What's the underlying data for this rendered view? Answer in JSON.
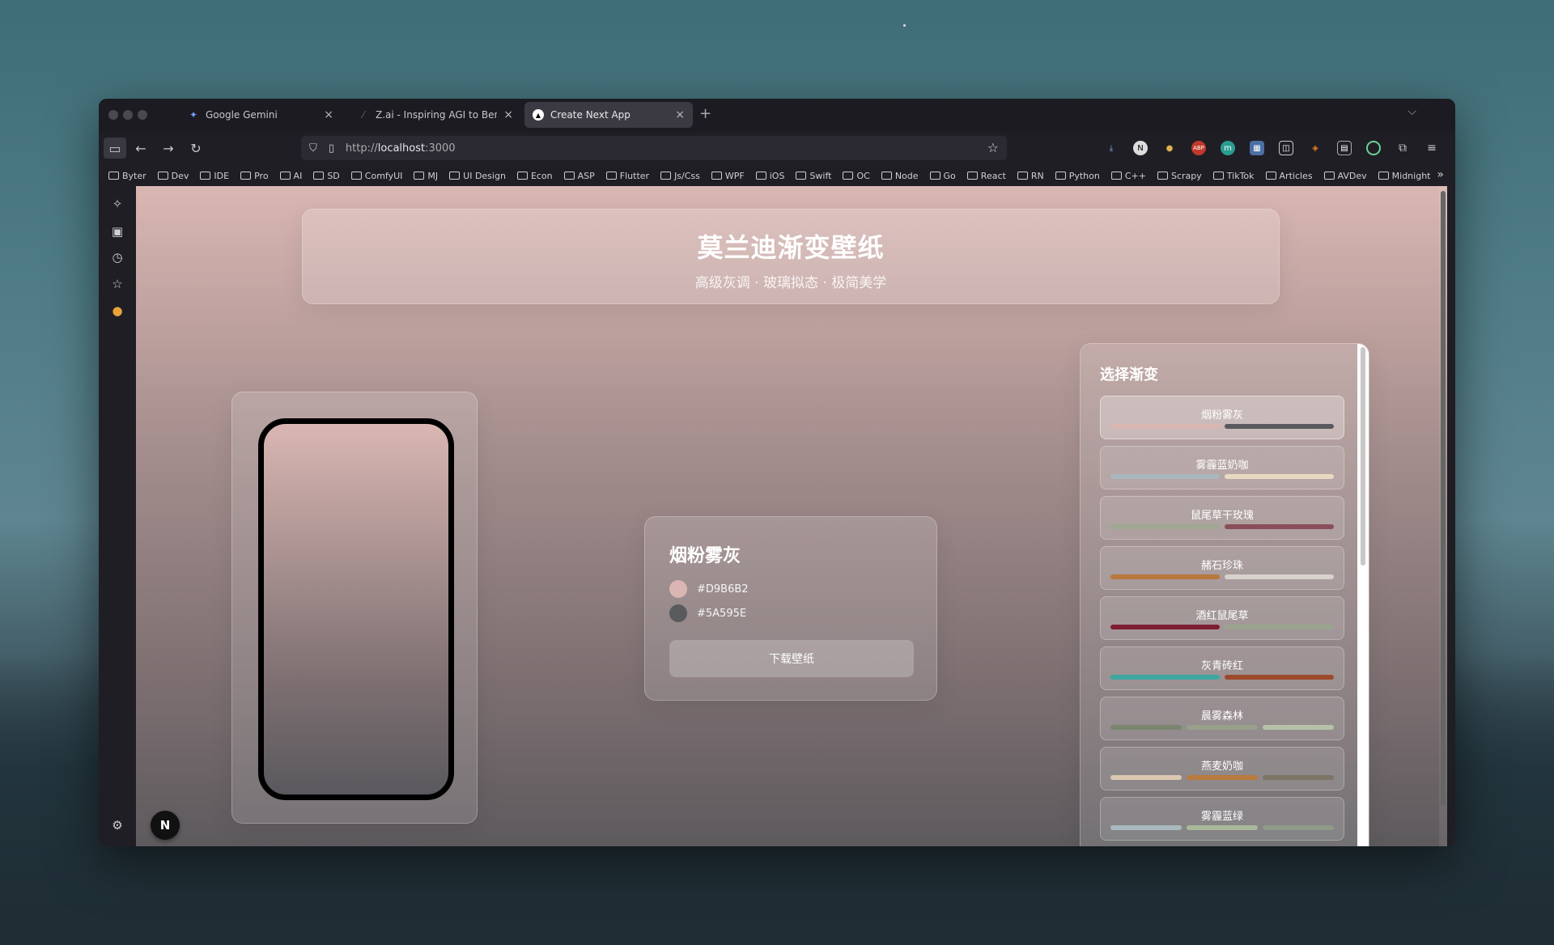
{
  "tabs": [
    {
      "title": "Google Gemini",
      "icon": "gemini-icon"
    },
    {
      "title": "Z.ai - Inspiring AGI to Benefit Humanity",
      "icon": "zai-icon"
    },
    {
      "title": "Create Next App",
      "icon": "nextjs-icon"
    }
  ],
  "url": {
    "scheme": "http://",
    "host": "localhost",
    "port": ":3000"
  },
  "bookmarks": [
    "Byter",
    "Dev",
    "IDE",
    "Pro",
    "AI",
    "SD",
    "ComfyUI",
    "MJ",
    "UI Design",
    "Econ",
    "ASP",
    "Flutter",
    "Js/Css",
    "WPF",
    "iOS",
    "Swift",
    "OC",
    "Node",
    "Go",
    "React",
    "RN",
    "Python",
    "C++",
    "Scrapy",
    "TikTok",
    "Articles",
    "AVDev",
    "Midnight"
  ],
  "header": {
    "title": "莫兰迪渐变壁纸",
    "subtitle": "高级灰调 · 玻璃拟态 · 极简美学"
  },
  "info": {
    "name": "烟粉雾灰",
    "colors": [
      {
        "hex": "#D9B6B2"
      },
      {
        "hex": "#5A595E"
      }
    ],
    "download_label": "下载壁纸"
  },
  "picker": {
    "title": "选择渐变",
    "options": [
      {
        "name": "烟粉雾灰",
        "colors": [
          "#D9B6B2",
          "#5A595E"
        ],
        "selected": true
      },
      {
        "name": "雾霾蓝奶咖",
        "colors": [
          "#A9B8BE",
          "#EAD9C2"
        ]
      },
      {
        "name": "鼠尾草干玫瑰",
        "colors": [
          "#9EA892",
          "#8A4E5A"
        ]
      },
      {
        "name": "赭石珍珠",
        "colors": [
          "#B8783E",
          "#D8D2CC"
        ]
      },
      {
        "name": "酒红鼠尾草",
        "colors": [
          "#7E1E32",
          "#9AA48E"
        ]
      },
      {
        "name": "灰青砖红",
        "colors": [
          "#3FA6A2",
          "#9C4A2C"
        ]
      },
      {
        "name": "晨雾森林",
        "colors": [
          "#7A8670",
          "#98A08C",
          "#B5C2A8"
        ]
      },
      {
        "name": "燕麦奶咖",
        "colors": [
          "#DCC8B0",
          "#B87B3E",
          "#7E7466"
        ]
      },
      {
        "name": "雾霾蓝绿",
        "colors": [
          "#A9B8BE",
          "#A8B89A",
          "#8F9A88"
        ]
      }
    ]
  },
  "next_badge": "N"
}
